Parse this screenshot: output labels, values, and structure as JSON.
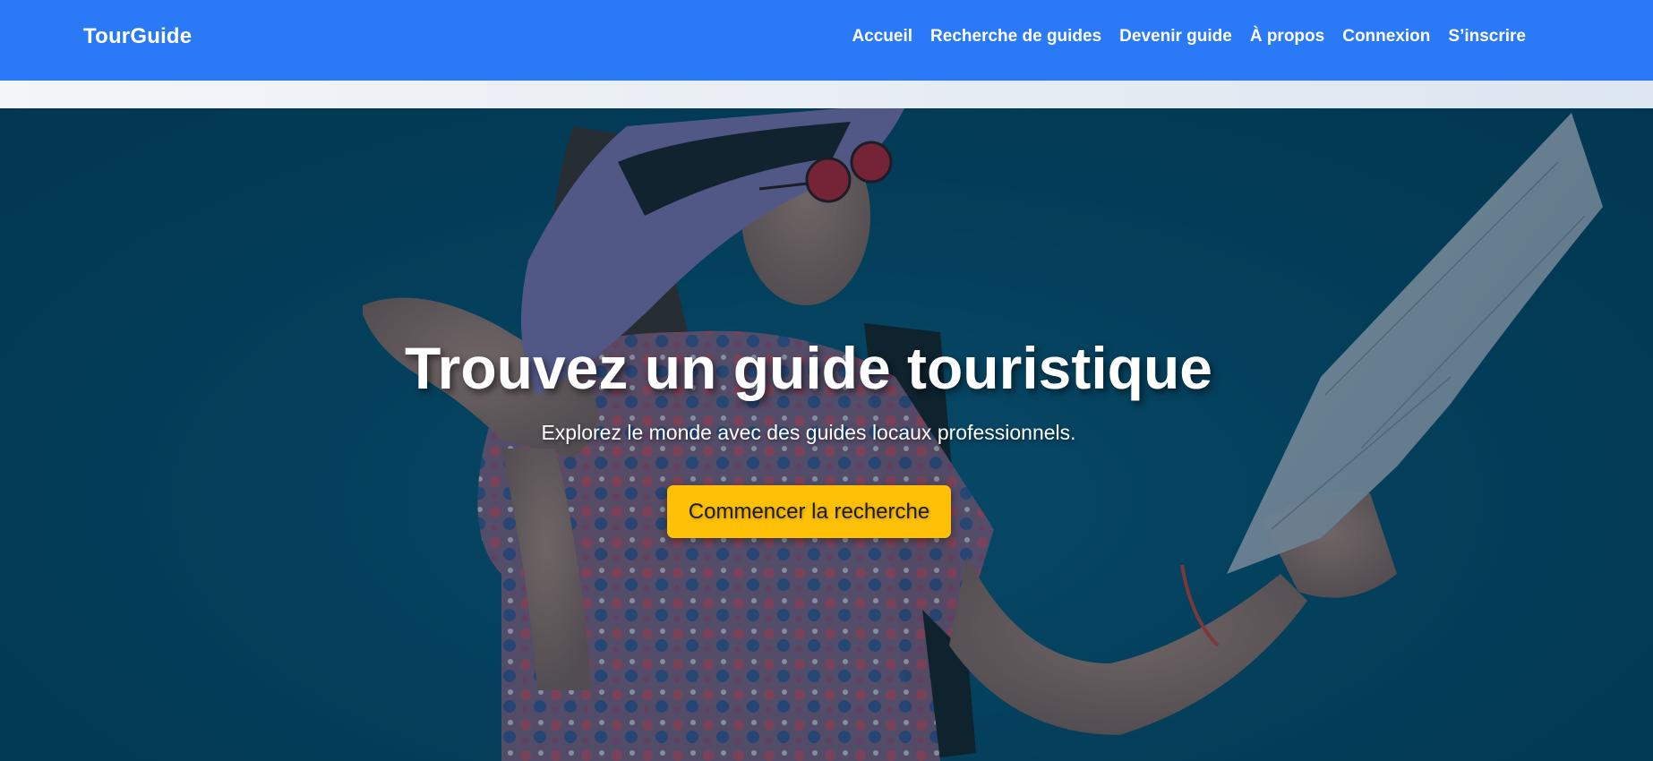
{
  "navbar": {
    "brand": "TourGuide",
    "links": [
      {
        "label": "Accueil"
      },
      {
        "label": "Recherche de guides"
      },
      {
        "label": "Devenir guide"
      },
      {
        "label": "À propos"
      },
      {
        "label": "Connexion"
      },
      {
        "label": "S’inscrire"
      }
    ]
  },
  "hero": {
    "title": "Trouvez un guide touristique",
    "subtitle": "Explorez le monde avec des guides locaux professionnels.",
    "cta_label": "Commencer la recherche"
  },
  "colors": {
    "navbar_bg": "#2a7af7",
    "hero_overlay": "#04405c",
    "cta_bg": "#ffc107",
    "text_light": "#ffffff"
  }
}
